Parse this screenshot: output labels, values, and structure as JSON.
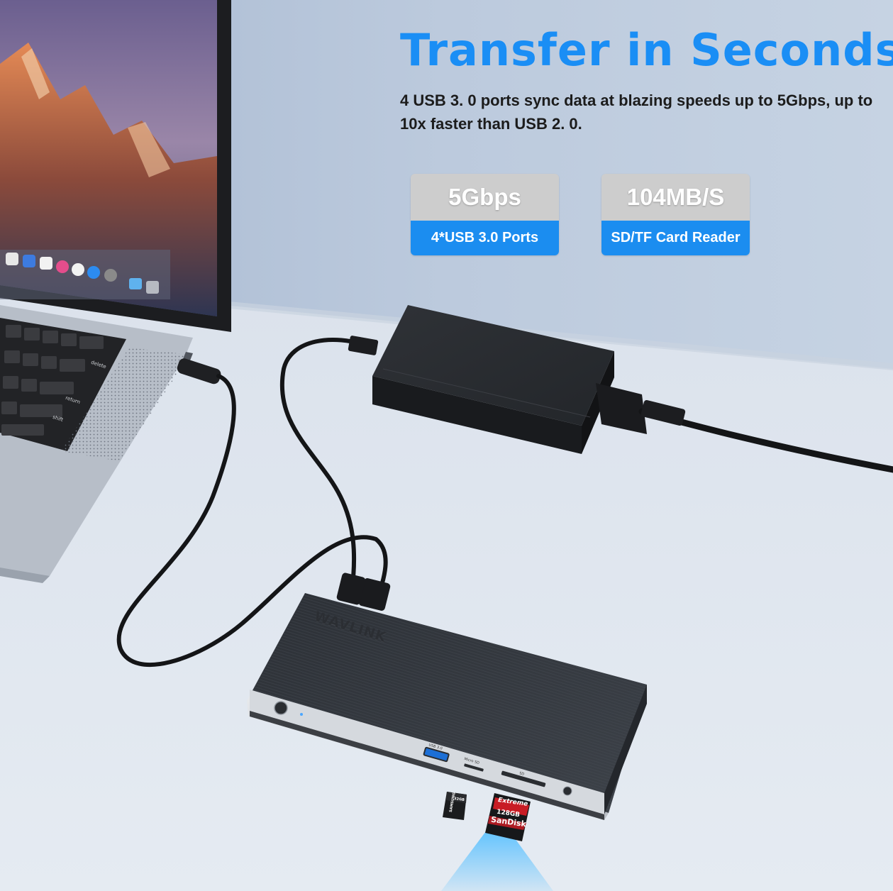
{
  "headline": "Transfer in Seconds",
  "subtitle": "4 USB 3. 0 ports sync data at blazing speeds up to 5Gbps, up to 10x faster than USB 2. 0.",
  "stats": [
    {
      "value": "5Gbps",
      "label": "4*USB 3.0 Ports"
    },
    {
      "value": "104MB/S",
      "label": "SD/TF Card Reader"
    }
  ],
  "brand_logo": "WAVLINK",
  "dock_labels": {
    "usb": "USB 3.0",
    "micro_sd": "Micro SD",
    "sd": "SD"
  },
  "keyboard_keys": {
    "delete": "delete",
    "return": "return",
    "shift": "shift"
  },
  "microsd_card": {
    "brand": "SAMSUNG",
    "capacity": "32GB"
  },
  "sd_card": {
    "line1": "Extreme",
    "line2": "128GB",
    "brand": "SanDisk"
  },
  "colors": {
    "accent": "#1a8ef5",
    "badge_top": "#cdcdcd",
    "badge_bottom": "#1b8df0",
    "wall": "#b8c8dd",
    "desk": "#dde5ef"
  },
  "icons": [
    "laptop",
    "usb-c-cable",
    "power-adapter",
    "docking-station",
    "microsd-card",
    "sd-card"
  ]
}
